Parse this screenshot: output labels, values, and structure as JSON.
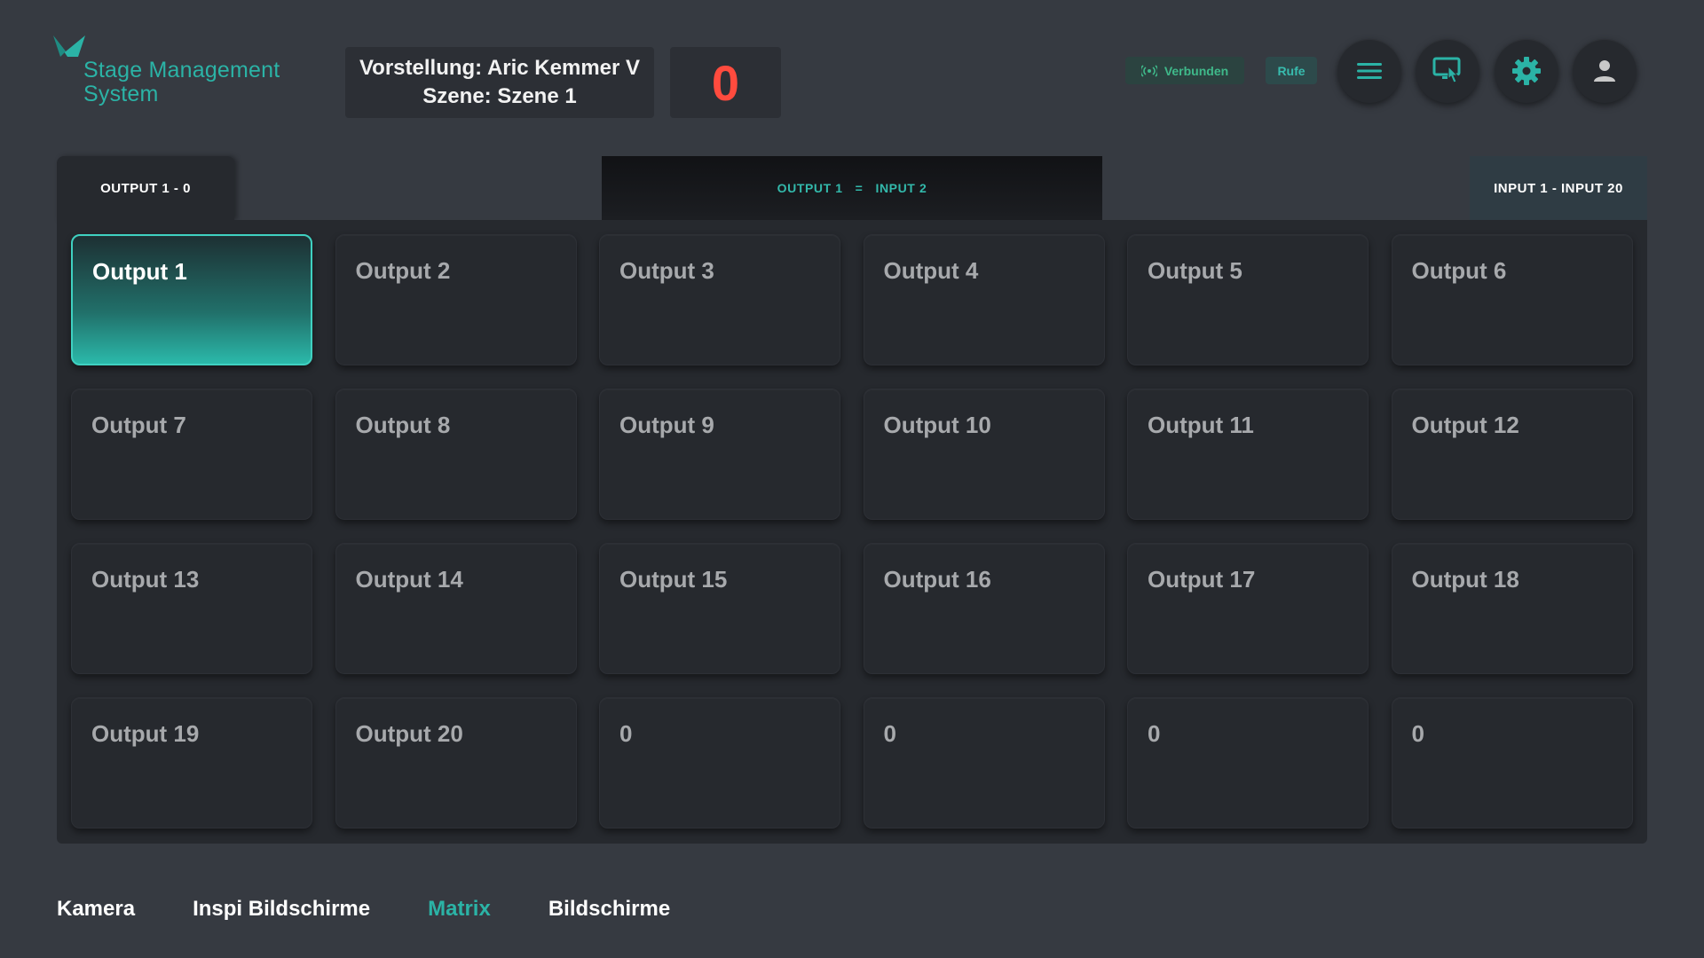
{
  "header": {
    "logo_text": "Stage Management System",
    "logo_line1": "Stage Management",
    "logo_line2": "System",
    "show_line": "Vorstellung: Aric Kemmer V",
    "scene_line": "Szene: Szene 1",
    "counter": "0",
    "status_connected": "Verbunden",
    "calls_label": "Rufe",
    "icons": [
      "menu-icon",
      "touch-screen-icon",
      "gear-icon",
      "user-icon"
    ]
  },
  "tabs": {
    "left": "OUTPUT 1 - 0",
    "center_left": "OUTPUT 1",
    "center_eq": "=",
    "center_right": "INPUT 2",
    "right": "INPUT 1 - INPUT 20"
  },
  "grid": {
    "cells": [
      "Output 1",
      "Output 2",
      "Output 3",
      "Output 4",
      "Output 5",
      "Output 6",
      "Output 7",
      "Output 8",
      "Output 9",
      "Output 10",
      "Output 11",
      "Output 12",
      "Output 13",
      "Output 14",
      "Output 15",
      "Output 16",
      "Output 17",
      "Output 18",
      "Output 19",
      "Output 20",
      "0",
      "0",
      "0",
      "0"
    ],
    "selected": "Output 1"
  },
  "bottom_nav": {
    "items": [
      "Kamera",
      "Inspi Bildschirme",
      "Matrix",
      "Bildschirme"
    ],
    "active": "Matrix"
  },
  "colors": {
    "accent": "#2bb3a6",
    "background": "#363a41",
    "panel": "#26292e",
    "counter": "#ff4b3e"
  }
}
